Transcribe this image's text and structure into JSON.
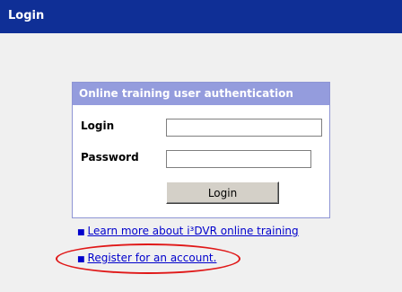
{
  "titlebar": {
    "title": "Login"
  },
  "auth": {
    "header": "Online training user authentication",
    "login_label": "Login",
    "login_value": "",
    "password_label": "Password",
    "password_value": "",
    "login_button": "Login"
  },
  "links": [
    {
      "text": "Learn more about i³DVR online training"
    },
    {
      "text": "Register for an account."
    }
  ],
  "colors": {
    "titlebar": "#0f2f96",
    "header": "#949cdd",
    "link": "#0000cc",
    "highlight": "#e01818"
  }
}
